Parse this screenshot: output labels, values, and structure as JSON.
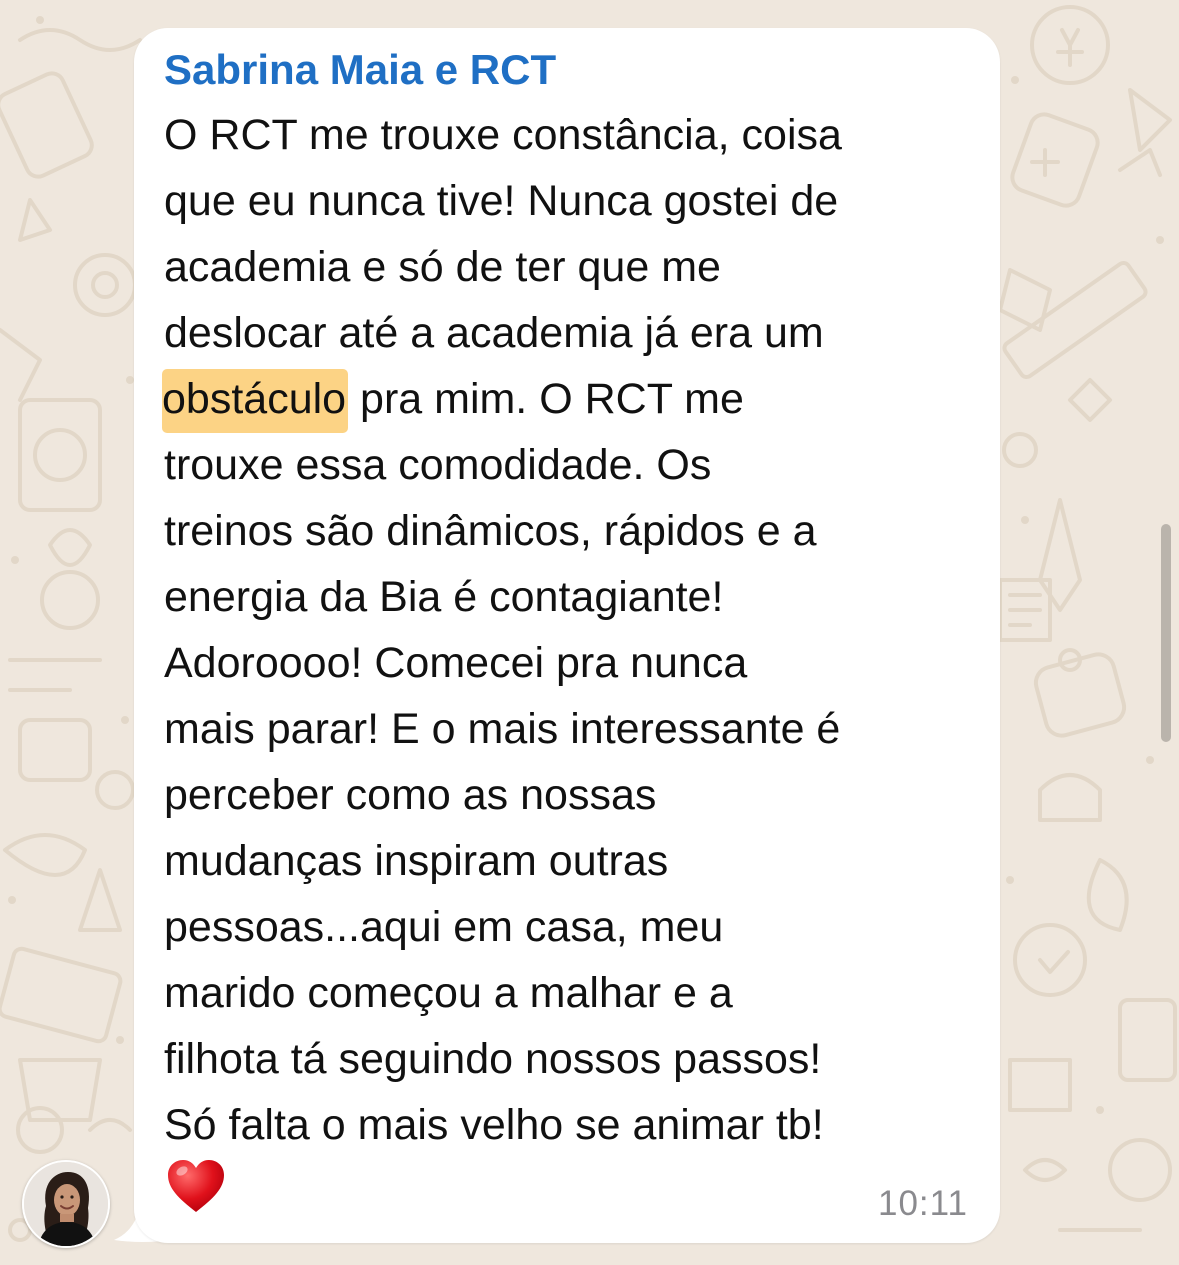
{
  "chat": {
    "wallpaper_color": "#efe7dd",
    "wallpaper_doodle_color": "#e2d7c8"
  },
  "message": {
    "sender": "Sabrina Maia e RCT",
    "sender_color": "#1f6fc4",
    "highlight_color": "#fcd385",
    "lines": [
      "O RCT me trouxe constância, coisa",
      "que eu nunca tive! Nunca gostei de",
      "academia e só de ter que me",
      "deslocar até a academia já era um",
      {
        "highlight": "obstáculo",
        "rest": " pra mim. O RCT me"
      },
      "trouxe essa comodidade. Os",
      "treinos são dinâmicos, rápidos e a",
      "energia da Bia é contagiante!",
      "Adoroooo! Comecei pra nunca",
      "mais parar! E o mais interessante é",
      "perceber como as nossas",
      "mudanças inspiram outras",
      "pessoas...aqui em casa, meu",
      "marido começou a malhar e a",
      "filhota tá seguindo nossos passos!",
      "Só falta o mais velho se animar tb!"
    ],
    "emoji": "heart-emoji",
    "time": "10:11"
  },
  "avatar": {
    "icon": "user-avatar"
  }
}
